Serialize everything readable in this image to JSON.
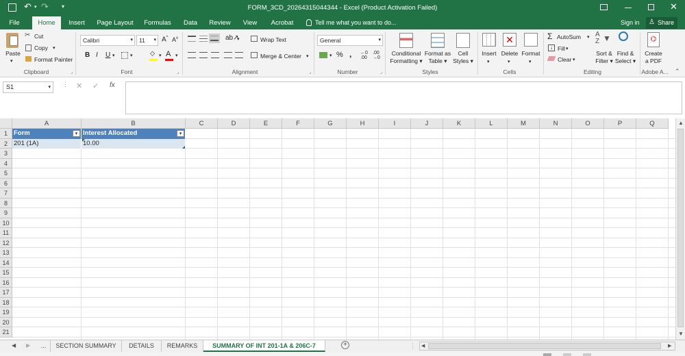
{
  "title": "FORM_3CD_20264315044344 - Excel (Product Activation Failed)",
  "tabs": [
    "File",
    "Home",
    "Insert",
    "Page Layout",
    "Formulas",
    "Data",
    "Review",
    "View",
    "Acrobat"
  ],
  "tellme": "Tell me what you want to do...",
  "signin": "Sign in",
  "share": "Share",
  "ribbon": {
    "clipboard": {
      "label": "Clipboard",
      "paste": "Paste",
      "cut": "Cut",
      "copy": "Copy",
      "format_painter": "Format Painter"
    },
    "font": {
      "label": "Font",
      "name": "Calibri",
      "size": "11"
    },
    "alignment": {
      "label": "Alignment",
      "wrap": "Wrap Text",
      "merge": "Merge & Center"
    },
    "number": {
      "label": "Number",
      "format": "General"
    },
    "styles": {
      "label": "Styles",
      "cond1": "Conditional",
      "cond2": "Formatting",
      "fmt1": "Format as",
      "fmt2": "Table",
      "cell1": "Cell",
      "cell2": "Styles"
    },
    "cells": {
      "label": "Cells",
      "insert": "Insert",
      "delete": "Delete",
      "format": "Format"
    },
    "editing": {
      "label": "Editing",
      "autosum": "AutoSum",
      "fill": "Fill",
      "clear": "Clear",
      "sort1": "Sort &",
      "sort2": "Filter",
      "find1": "Find &",
      "find2": "Select"
    },
    "adobe": {
      "label": "Adobe A...",
      "create1": "Create",
      "create2": "a PDF"
    }
  },
  "namebox": "S1",
  "columns": [
    "A",
    "B",
    "C",
    "D",
    "E",
    "F",
    "G",
    "H",
    "I",
    "J",
    "K",
    "L",
    "M",
    "N",
    "O",
    "P",
    "Q"
  ],
  "rows": [
    "1",
    "2",
    "3",
    "4",
    "5",
    "6",
    "7",
    "8",
    "9",
    "10",
    "11",
    "12",
    "13",
    "14",
    "15",
    "16",
    "17",
    "18",
    "19",
    "20",
    "21"
  ],
  "table": {
    "headers": [
      "Form",
      "Interest Allocated"
    ],
    "row1": [
      "201 (1A)",
      "10.00"
    ]
  },
  "sheets": [
    "...",
    "SECTION SUMMARY",
    "DETAILS",
    "REMARKS",
    "SUMMARY OF INT 201-1A & 206C-7"
  ],
  "colors": {
    "brand": "#217346",
    "table_header": "#4f81bd",
    "table_row": "#dce6f1"
  }
}
